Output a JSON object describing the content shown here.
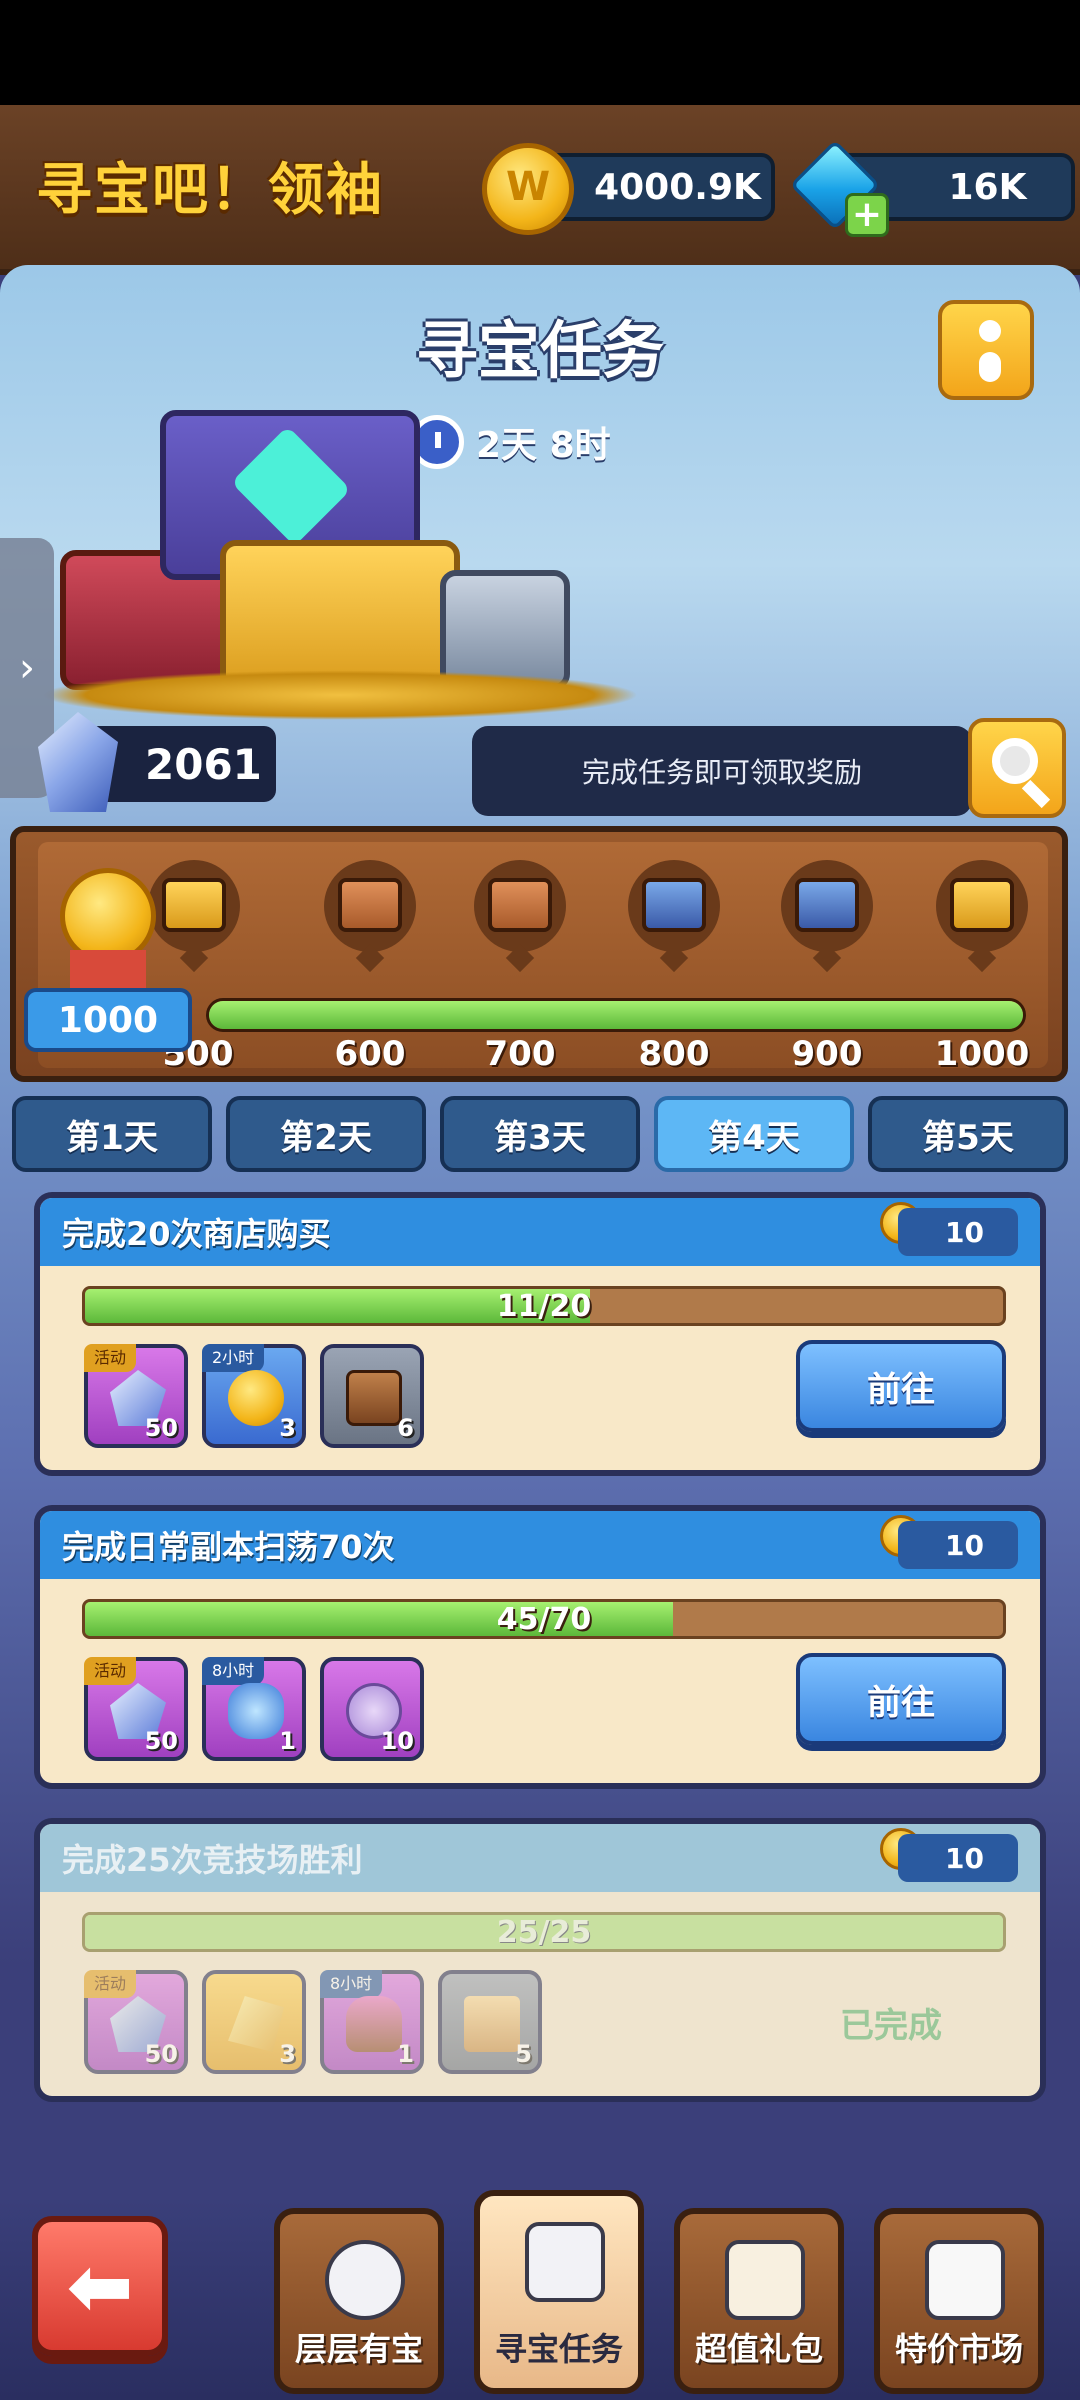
{
  "header": {
    "title": "寻宝吧！领袖",
    "gold": "4000.9K",
    "gems": "16K"
  },
  "panel": {
    "title": "寻宝任务",
    "timer": "2天 8时",
    "crystals": "2061",
    "hint": "完成任务即可领取奖励"
  },
  "milestones": {
    "current_score": "1000",
    "labels": [
      "500",
      "600",
      "700",
      "800",
      "900",
      "1000"
    ],
    "progress": 1.0
  },
  "day_tabs": [
    {
      "label": "第1天"
    },
    {
      "label": "第2天"
    },
    {
      "label": "第3天"
    },
    {
      "label": "第4天"
    },
    {
      "label": "第5天"
    }
  ],
  "active_day": 3,
  "tasks": [
    {
      "title": "完成20次商店购买",
      "reward": "10",
      "progress_text": "11/20",
      "progress": 0.55,
      "items": [
        {
          "tag": "活动",
          "qty": "50",
          "icon": "crystal-icon"
        },
        {
          "tag": "2小时",
          "qty": "3",
          "icon": "coin-icon"
        },
        {
          "tag": "",
          "qty": "6",
          "icon": "chest-icon"
        }
      ],
      "action": "前往"
    },
    {
      "title": "完成日常副本扫荡70次",
      "reward": "10",
      "progress_text": "45/70",
      "progress": 0.64,
      "items": [
        {
          "tag": "活动",
          "qty": "50",
          "icon": "crystal-icon"
        },
        {
          "tag": "8小时",
          "qty": "1",
          "icon": "gem-pile-icon"
        },
        {
          "tag": "",
          "qty": "10",
          "icon": "token-icon"
        }
      ],
      "action": "前往"
    },
    {
      "title": "完成25次竞技场胜利",
      "reward": "10",
      "progress_text": "25/25",
      "progress": 1.0,
      "items": [
        {
          "tag": "活动",
          "qty": "50",
          "icon": "crystal-icon"
        },
        {
          "tag": "",
          "qty": "3",
          "icon": "gold-shard-icon"
        },
        {
          "tag": "8小时",
          "qty": "1",
          "icon": "ore-bag-icon"
        },
        {
          "tag": "",
          "qty": "5",
          "icon": "scroll-icon"
        }
      ],
      "status": "已完成"
    }
  ],
  "bottom_nav": [
    {
      "label": "层层有宝"
    },
    {
      "label": "寻宝任务"
    },
    {
      "label": "超值礼包"
    },
    {
      "label": "特价市场"
    }
  ]
}
